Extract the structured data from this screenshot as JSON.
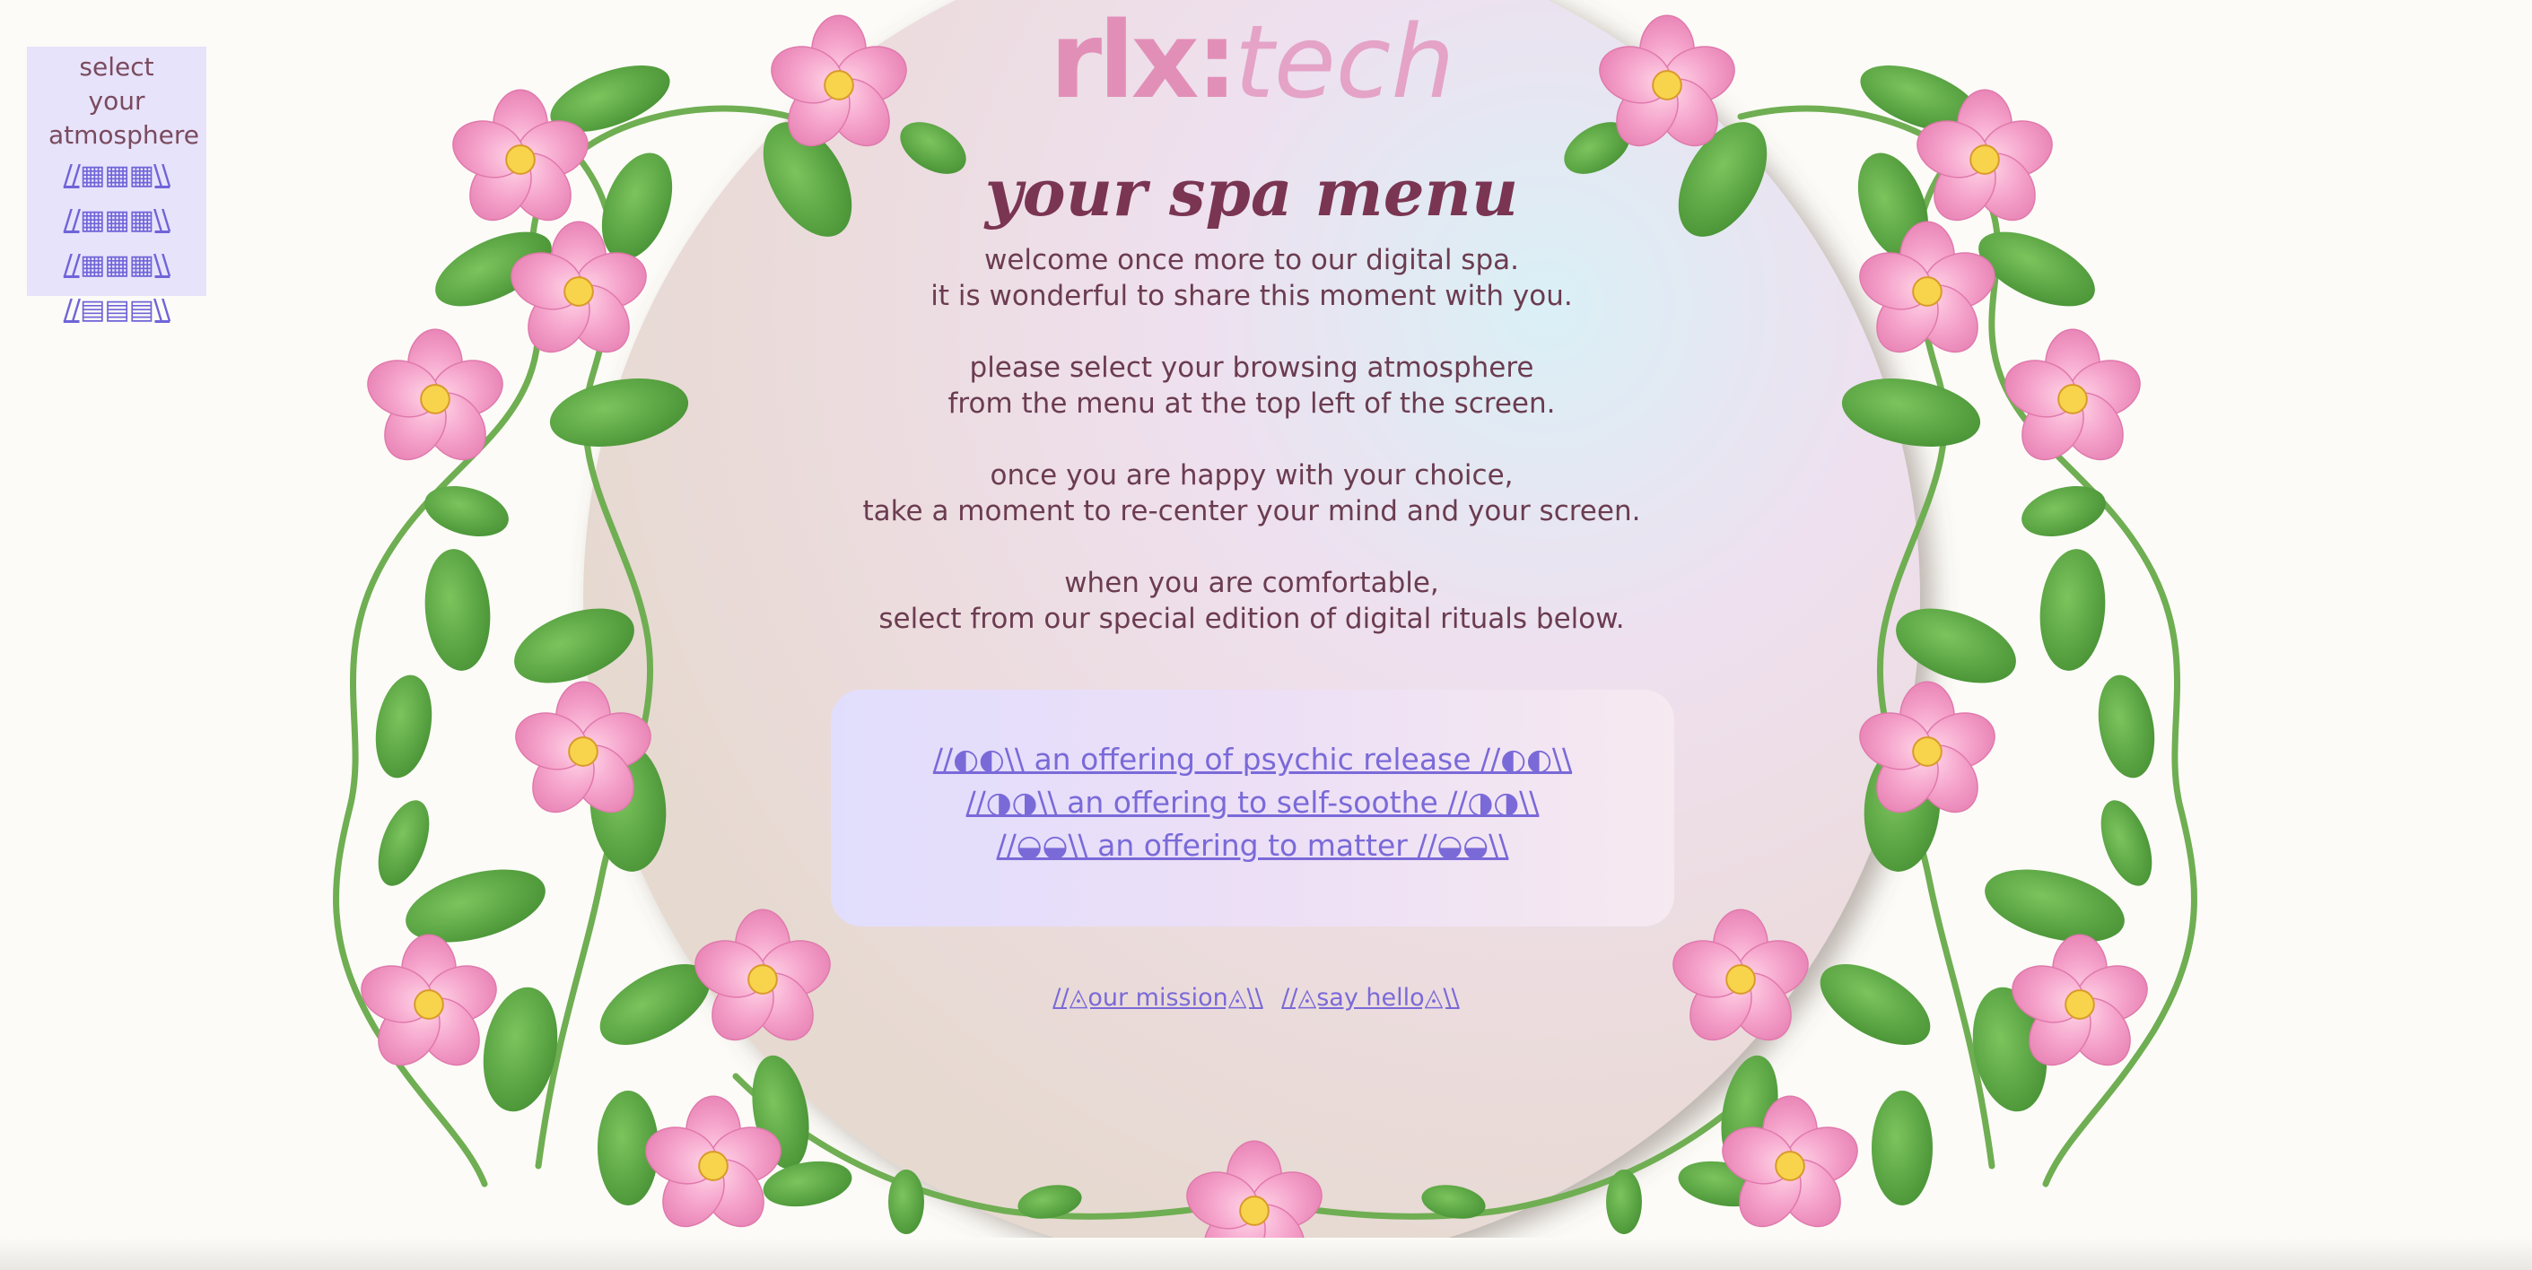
{
  "theme": {
    "page_bg": "#fcfbf7",
    "menu_bg": "#e7e3fb",
    "link_color": "#7a6ad8",
    "text_color": "#6b3c50",
    "heading_color": "#7a3552",
    "logo_color": "#e28fb8",
    "leaf_color": "#57a142",
    "blossom_color": "#f29bc8"
  },
  "atmosphere_menu": {
    "title": "select your atmosphere",
    "options": [
      "//▦▦▦\\\\",
      "//▦▦▦\\\\",
      "//▦▦▦\\\\",
      "//▤▤▤\\\\"
    ]
  },
  "logo": {
    "main": "rlx:",
    "sub": "tech"
  },
  "heading": "your spa menu",
  "intro": {
    "paragraphs": [
      [
        "welcome once more to our digital spa.",
        "it is wonderful to share this moment with you."
      ],
      [
        "please select your browsing atmosphere",
        "from the menu at the top left of the screen."
      ],
      [
        "once you are happy with your choice,",
        "take a moment to re-center your mind and your screen."
      ],
      [
        "when you are comfortable,",
        "select from our special edition of digital rituals below."
      ]
    ]
  },
  "rituals": [
    "//◐◐\\\\ an offering of psychic release //◐◐\\\\",
    "//◑◑\\\\ an offering to self-soothe //◑◑\\\\",
    "//◒◒\\\\ an offering to matter //◒◒\\\\"
  ],
  "footer_links": [
    "//◬our mission◬\\\\",
    "//◬say hello◬\\\\"
  ]
}
